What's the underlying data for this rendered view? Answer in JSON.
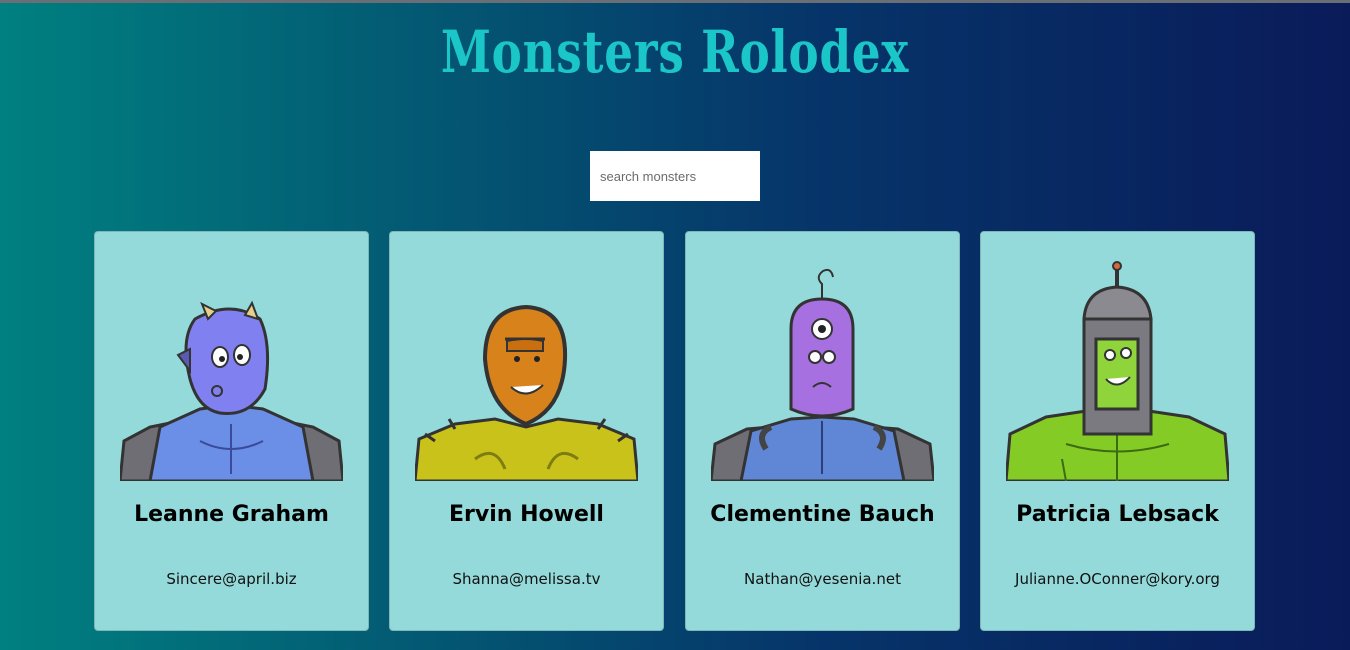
{
  "app": {
    "title": "Monsters Rolodex"
  },
  "search": {
    "placeholder": "search monsters",
    "value": ""
  },
  "monsters": [
    {
      "name": "Leanne Graham",
      "email": "Sincere@april.biz",
      "avatar_icon": "blue-horned-monster-icon"
    },
    {
      "name": "Ervin Howell",
      "email": "Shanna@melissa.tv",
      "avatar_icon": "orange-spiky-monster-icon"
    },
    {
      "name": "Clementine Bauch",
      "email": "Nathan@yesenia.net",
      "avatar_icon": "purple-cyclops-robot-monster-icon"
    },
    {
      "name": "Patricia Lebsack",
      "email": "Julianne.OConner@kory.org",
      "avatar_icon": "green-helmet-monster-icon"
    }
  ],
  "colors": {
    "background_start": "#008080",
    "background_end": "#0a1b5a",
    "title": "#1ac6c8",
    "card": "#95dada"
  }
}
